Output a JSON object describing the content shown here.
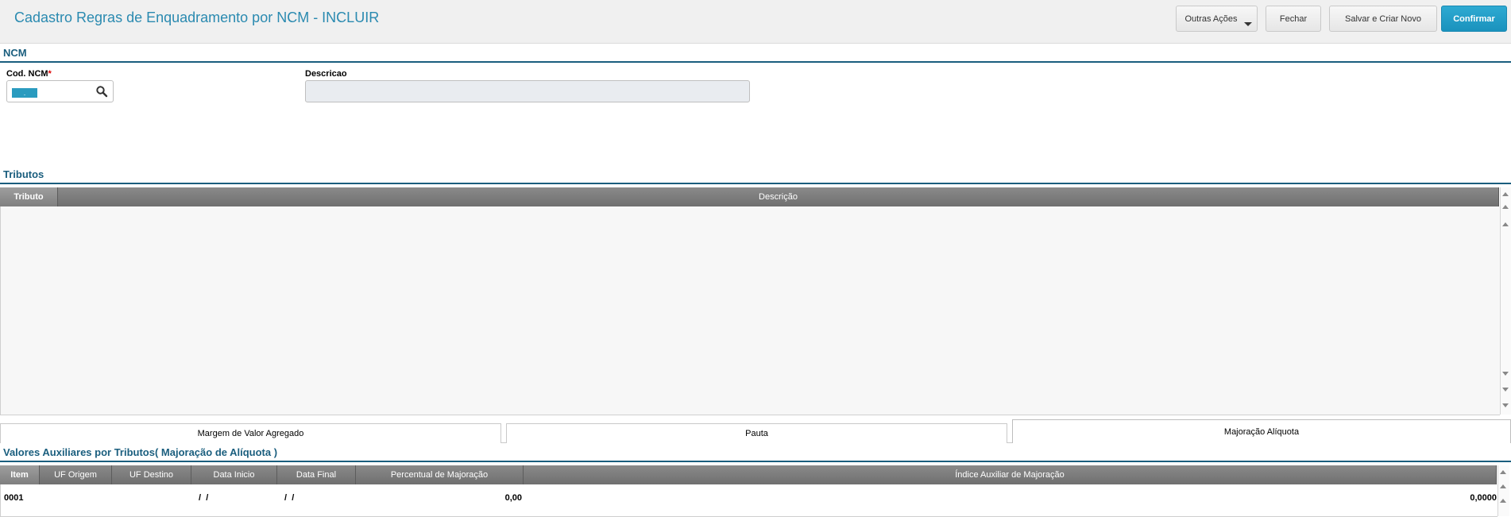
{
  "header": {
    "title": "Cadastro Regras de Enquadramento por NCM - INCLUIR",
    "buttons": {
      "outras_acoes": "Outras Ações",
      "fechar": "Fechar",
      "salvar_criar": "Salvar e Criar Novo",
      "confirmar": "Confirmar"
    },
    "accent_color": "#1a92bd"
  },
  "ncm_section": {
    "title": "NCM",
    "cod_label": "Cod. NCM",
    "required_mark": "*",
    "cod_value": ".",
    "descricao_label": "Descricao",
    "descricao_value": ""
  },
  "tributos_section": {
    "title": "Tributos",
    "columns": [
      "Tributo",
      "Descrição"
    ],
    "rows": []
  },
  "folders": {
    "tabs": [
      "Margem de Valor Agregado",
      "Pauta",
      "Majoração Alíquota"
    ],
    "active": "Majoração Alíquota"
  },
  "valores_section": {
    "title": "Valores Auxiliares por Tributos( Majoração de Alíquota )",
    "columns": [
      "Item",
      "UF Origem",
      "UF Destino",
      "Data Inicio",
      "Data Final",
      "Percentual de Majoração",
      "Índice Auxiliar de Majoração"
    ],
    "rows": [
      {
        "item": "0001",
        "uf_origem": "",
        "uf_destino": "",
        "data_inicio": " /  /",
        "data_final": " /  /",
        "percentual": "0,00",
        "indice": "0,0000"
      }
    ]
  }
}
